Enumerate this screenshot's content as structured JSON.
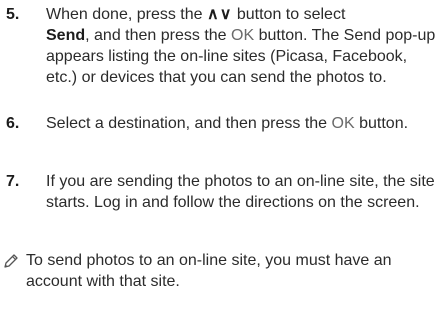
{
  "steps": [
    {
      "number": "5.",
      "t1": "When done, press the",
      "glyph": "∧∨",
      "t2": " button to select",
      "strong": "Send",
      "t3": ", and then press the ",
      "ok": "OK",
      "t4": " button. The Send pop-up appears listing the on-line sites (Picasa, Facebook, etc.) or devices that you can send the photos to."
    },
    {
      "number": "6.",
      "t1": "Select a destination, and then press the ",
      "ok": "OK",
      "t2": " button."
    },
    {
      "number": "7.",
      "text": "If you are sending the photos to an on-line site, the site starts. Log in and follow the directions on the screen."
    }
  ],
  "note": {
    "icon": "note-pencil-icon",
    "text": "To send photos to an on-line site, you must have an account with that site."
  }
}
